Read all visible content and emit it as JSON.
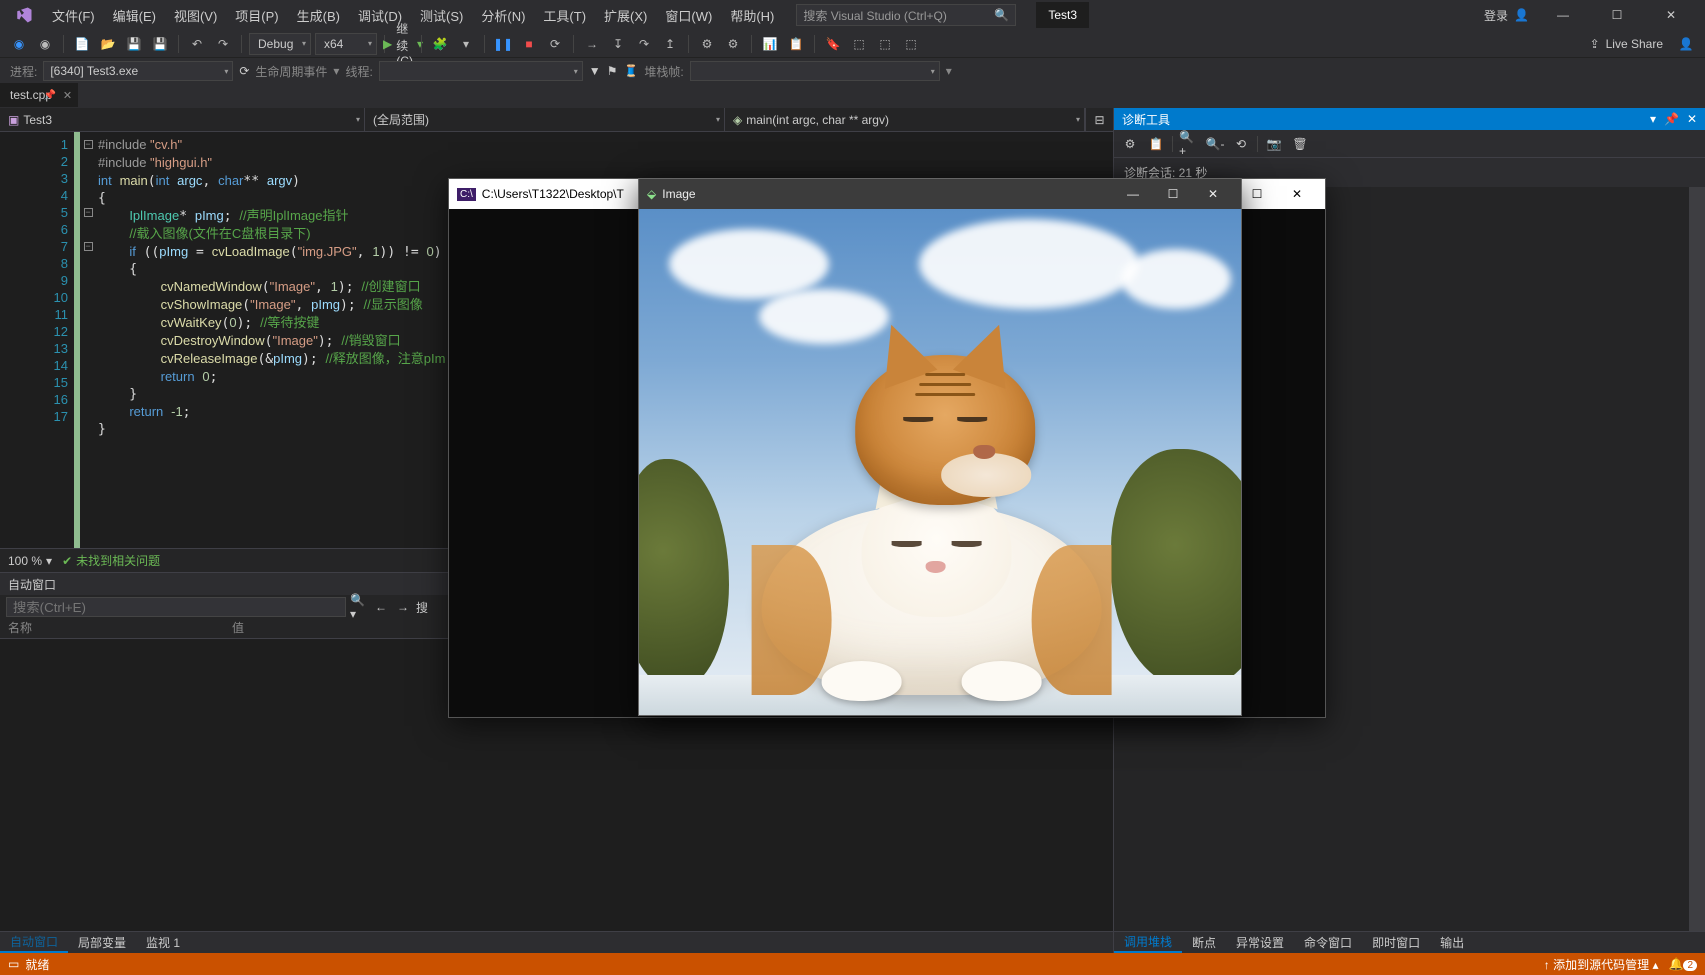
{
  "menu": {
    "items": [
      "文件(F)",
      "编辑(E)",
      "视图(V)",
      "项目(P)",
      "生成(B)",
      "调试(D)",
      "测试(S)",
      "分析(N)",
      "工具(T)",
      "扩展(X)",
      "窗口(W)",
      "帮助(H)"
    ],
    "search_placeholder": "搜索 Visual Studio (Ctrl+Q)",
    "project_name": "Test3",
    "login": "登录"
  },
  "toolbar": {
    "config": "Debug",
    "platform": "x64",
    "continue": "继续(C)",
    "liveshare": "Live Share"
  },
  "procbar": {
    "label_proc": "进程:",
    "proc_value": "[6340] Test3.exe",
    "label_lifecycle": "生命周期事件",
    "label_thread": "线程:",
    "label_stackframe": "堆栈帧:"
  },
  "tab": {
    "name": "test.cpp"
  },
  "codenav": {
    "scope": "Test3",
    "global": "(全局范围)",
    "func": "main(int argc, char ** argv)"
  },
  "code_lines": [
    "#include \"cv.h\"",
    "#include \"highgui.h\"",
    "int main(int argc, char** argv)",
    "{",
    "    IplImage* pImg; //声明IplImage指针",
    "    //载入图像(文件在C盘根目录下)",
    "    if ((pImg = cvLoadImage(\"img.JPG\", 1)) != 0)",
    "    {",
    "        cvNamedWindow(\"Image\", 1); //创建窗口",
    "        cvShowImage(\"Image\", pImg); //显示图像",
    "        cvWaitKey(0); //等待按键",
    "        cvDestroyWindow(\"Image\"); //销毁窗口",
    "        cvReleaseImage(&pImg); //释放图像，注意pImg",
    "        return 0;",
    "    }",
    "    return -1;",
    "}"
  ],
  "zoom": {
    "pct": "100 %",
    "issues": "未找到相关问题"
  },
  "autos": {
    "title": "自动窗口",
    "search_placeholder": "搜索(Ctrl+E)",
    "col_name": "名称",
    "col_value": "值",
    "search_depth_label": "搜"
  },
  "panel_tabs_left": [
    "自动窗口",
    "局部变量",
    "监视 1"
  ],
  "panel_tabs_right": [
    "调用堆栈",
    "断点",
    "异常设置",
    "命令窗口",
    "即时窗口",
    "输出"
  ],
  "diag": {
    "title": "诊断工具",
    "session": "诊断会话: 21 秒"
  },
  "status": {
    "ready": "就绪",
    "scm": "添加到源代码管理",
    "notif_count": "2"
  },
  "console": {
    "title": "C:\\Users\\T1322\\Desktop\\T"
  },
  "imgwin": {
    "title": "Image"
  }
}
